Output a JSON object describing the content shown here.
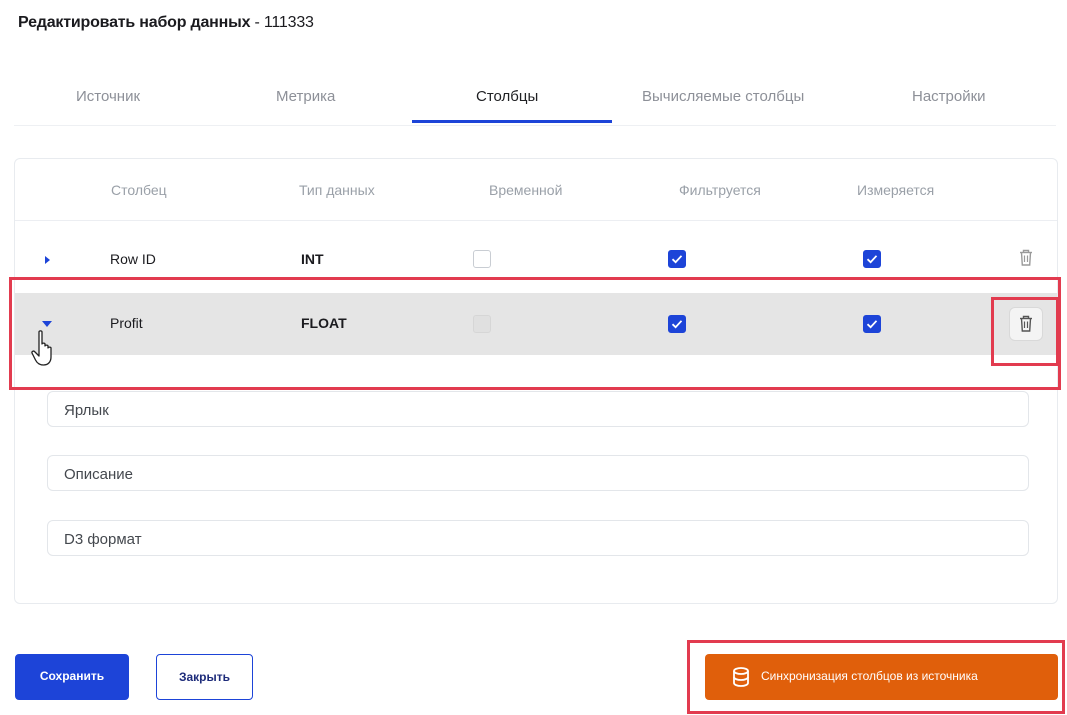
{
  "page": {
    "title": "Редактировать набор данных",
    "title_suffix": " - 111333"
  },
  "tabs": [
    {
      "label": "Источник",
      "active": false
    },
    {
      "label": "Метрика",
      "active": false
    },
    {
      "label": "Столбцы",
      "active": true
    },
    {
      "label": "Вычисляемые столбцы",
      "active": false
    },
    {
      "label": "Настройки",
      "active": false
    }
  ],
  "table": {
    "headers": [
      "Столбец",
      "Тип данных",
      "Временной",
      "Фильтруется",
      "Измеряется"
    ],
    "rows": [
      {
        "name": "Row ID",
        "type": "INT",
        "temporal": false,
        "filterable": true,
        "measurable": true,
        "expanded": false
      },
      {
        "name": "Profit",
        "type": "FLOAT",
        "temporal": false,
        "filterable": true,
        "measurable": true,
        "expanded": true
      }
    ]
  },
  "details": {
    "label_placeholder": "Ярлык",
    "description_placeholder": "Описание",
    "d3_format_placeholder": "D3 формат"
  },
  "footer": {
    "save_label": "Сохранить",
    "close_label": "Закрыть",
    "sync_label": "Синхронизация столбцов из источника"
  },
  "icons": {
    "trash": "trash-icon",
    "database": "database-icon",
    "check": "check-icon",
    "caret_right": "caret-right-icon",
    "caret_down": "caret-down-icon",
    "cursor": "hand-cursor-icon"
  },
  "colors": {
    "accent": "#1d44d8",
    "sync_button": "#e05f0b",
    "highlight": "#e23b4f",
    "selected_row": "#e5e5e5"
  }
}
